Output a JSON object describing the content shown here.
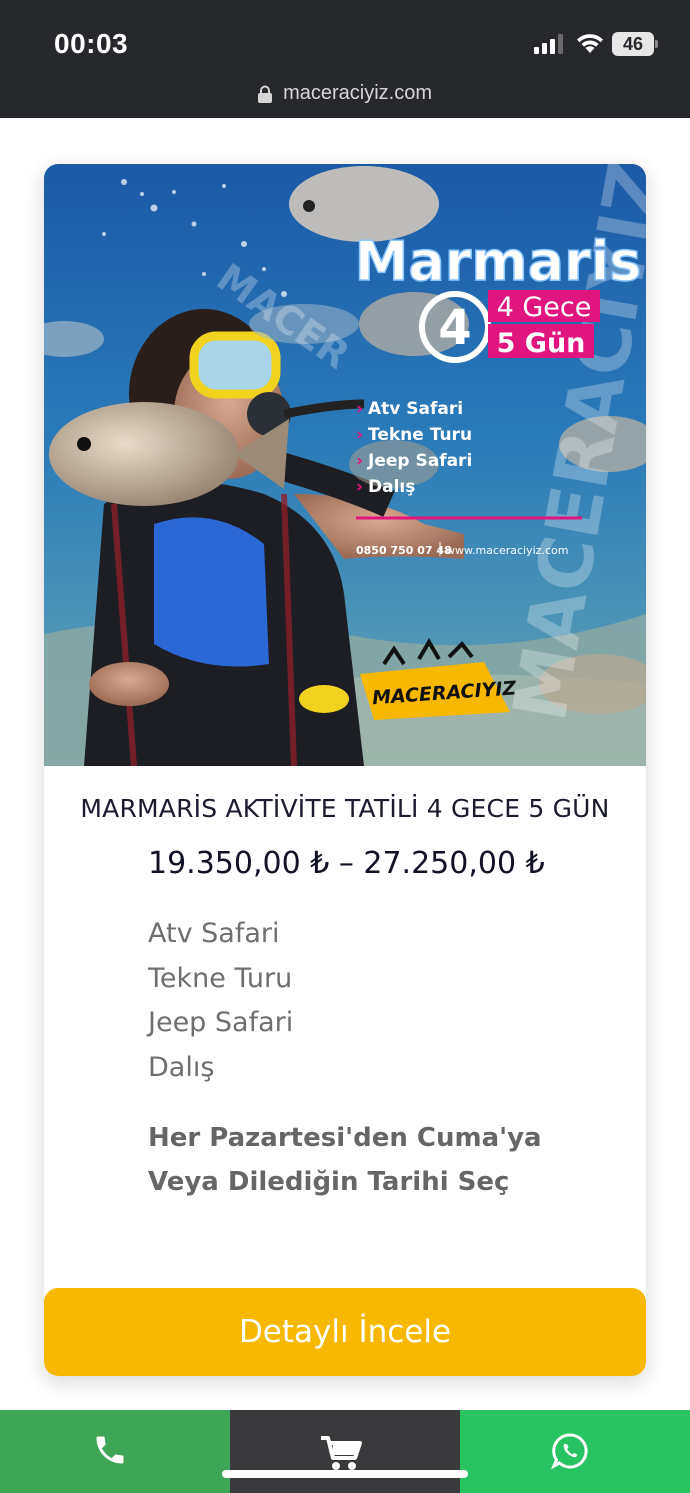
{
  "status_bar": {
    "time": "00:03",
    "battery": "46"
  },
  "browser": {
    "url": "maceraciyiz.com"
  },
  "product": {
    "image": {
      "brand_text": "Marmaris",
      "night_badge": "4",
      "nights": "4 Gece",
      "days": "5 Gün",
      "activities": [
        "Atv Safari",
        "Tekne Turu",
        "Jeep Safari",
        "Dalış"
      ],
      "phone": "0850 750 07 48",
      "website": "www.maceraciyiz.com",
      "logo_text": "MACERACIYIZ"
    },
    "title": "MARMARİS AKTİVİTE TATİLİ 4 GECE 5 GÜN",
    "price": "19.350,00 ₺ – 27.250,00 ₺",
    "features": [
      "Atv Safari",
      "Tekne Turu",
      "Jeep Safari",
      "Dalış"
    ],
    "schedule_line1": "Her Pazartesi'den Cuma'ya",
    "schedule_line2": "Veya Dilediğin Tarihi Seç",
    "cta_label": "Detaylı İncele"
  },
  "colors": {
    "accent": "#f8b800",
    "call": "#3fa656",
    "cart": "#3a3a3d",
    "whatsapp": "#26c360",
    "magenta": "#e0157f"
  }
}
